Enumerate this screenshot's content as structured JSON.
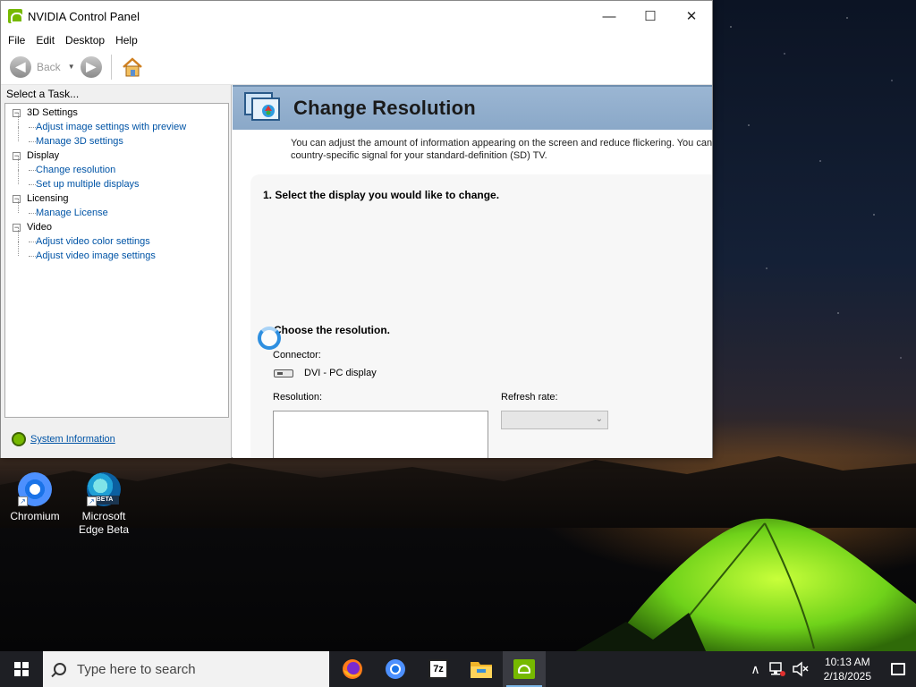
{
  "window": {
    "title": "NVIDIA Control Panel",
    "minimize_glyph": "—",
    "maximize_glyph": "☐",
    "close_glyph": "✕"
  },
  "menu": [
    "File",
    "Edit",
    "Desktop",
    "Help"
  ],
  "toolbar": {
    "back_label": "Back",
    "back_glyph": "◀",
    "forward_glyph": "▶",
    "dropdown_glyph": "▼"
  },
  "task_pane": {
    "header": "Select a Task...",
    "tree": [
      {
        "category": "3D Settings",
        "items": [
          "Adjust image settings with preview",
          "Manage 3D settings"
        ]
      },
      {
        "category": "Display",
        "items": [
          "Change resolution",
          "Set up multiple displays"
        ]
      },
      {
        "category": "Licensing",
        "items": [
          "Manage License"
        ]
      },
      {
        "category": "Video",
        "items": [
          "Adjust video color settings",
          "Adjust video image settings"
        ]
      }
    ],
    "expander_glyph": "−",
    "system_information": "System Information"
  },
  "content": {
    "title": "Change Resolution",
    "description_line1": "You can adjust the amount of information appearing on the screen and reduce flickering. You can als",
    "description_line2": "country-specific signal for your standard-definition (SD) TV.",
    "step1": "1. Select the display you would like to change.",
    "step2": "Choose the resolution.",
    "connector_label": "Connector:",
    "connector_value": "DVI - PC display",
    "resolution_label": "Resolution:",
    "refresh_label": "Refresh rate:",
    "refresh_value": "",
    "select_arrow": "⌄"
  },
  "desktop_icons": [
    {
      "label_line1": "Chromium",
      "label_line2": ""
    },
    {
      "label_line1": "Microsoft",
      "label_line2": "Edge Beta",
      "badge": "BETA"
    }
  ],
  "taskbar": {
    "search_placeholder": "Type here to search",
    "apps": [
      "firefox",
      "chrome",
      "7-zip",
      "file-explorer",
      "nvidia-control-panel"
    ],
    "sevenzip_label": "7z",
    "time": "10:13 AM",
    "date": "2/18/2025",
    "chevron_glyph": "∧"
  },
  "colors": {
    "nvidia_green": "#76b900",
    "banner_blue": "#9bb6d3",
    "link_blue": "#0054a6",
    "taskbar_bg": "#1e1f24"
  }
}
